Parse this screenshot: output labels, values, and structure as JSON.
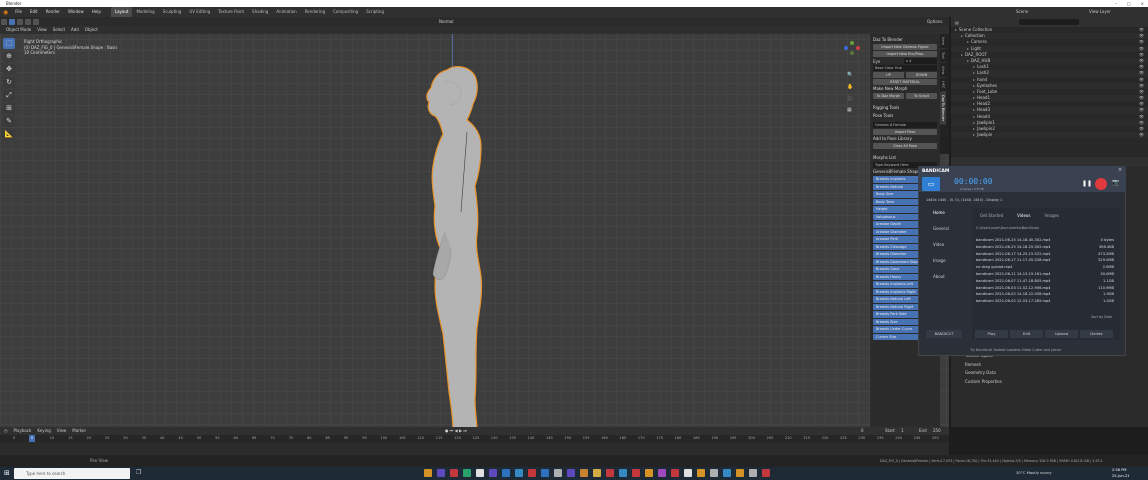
{
  "window": {
    "title": "Blender"
  },
  "menu": {
    "items": [
      "File",
      "Edit",
      "Render",
      "Window",
      "Help"
    ],
    "workspaces": [
      "Layout",
      "Modeling",
      "Sculpting",
      "UV Editing",
      "Texture Paint",
      "Shading",
      "Animation",
      "Rendering",
      "Compositing",
      "Scripting"
    ],
    "active_workspace": "Layout",
    "scene_label": "Scene",
    "view_layer_label": "View Layer"
  },
  "viewport": {
    "mode": "Object Mode",
    "menus": [
      "View",
      "Select",
      "Add",
      "Object"
    ],
    "orientation": "Normal",
    "options_label": "Options",
    "info_line1": "Right Orthographic",
    "info_line2": "(0) DAZ_FIG_0 | Genesis8Female.Shape : Basis",
    "info_line3": "10 Centimeters"
  },
  "npanel": {
    "day_to_blender_title": "Daz To Blender",
    "import_new_genesis": "Import New Genesis Figure",
    "import_new_env": "Import New Env/Prop",
    "eye_label": "Eye",
    "eye_value": "x 4",
    "base_color_hue": "Base Color Hue",
    "up_label": "UP",
    "down_label": "DOWN",
    "reset_material": "RESET MATERIAL",
    "make_new_morph": "Make New Morph",
    "to_daz_morph": "To Daz Morph",
    "to_script": "To Script",
    "rigging_tools": "Rigging Tools",
    "pose_tools": "Pose Tools",
    "pose_preset": "Genesis 8 Female",
    "import_pose": "Import Pose",
    "add_to_pose_library": "Add to Pose Library",
    "clear_all_pose": "Clear All Pose",
    "morphs_list": "Morphs List",
    "search_placeholder": "Type Keyword Here",
    "shape_key": "Genesis8Female.Shape",
    "morphs": [
      {
        "name": "Breasts Implants",
        "value": ""
      },
      {
        "name": "Breasts Natural",
        "value": ""
      },
      {
        "name": "Body Size",
        "value": ""
      },
      {
        "name": "Body Tone",
        "value": ""
      },
      {
        "name": "Height",
        "value": ""
      },
      {
        "name": "Voluptuous",
        "value": ""
      },
      {
        "name": "Areolae Depth",
        "value": ""
      },
      {
        "name": "Areolae Diameter",
        "value": ""
      },
      {
        "name": "Areolae Perk",
        "value": ""
      },
      {
        "name": "Breasts Cleavage",
        "value": ""
      },
      {
        "name": "Breasts Diameter",
        "value": ""
      },
      {
        "name": "Breasts Downward Slope",
        "value": ""
      },
      {
        "name": "Breasts Gone",
        "value": "0.000"
      },
      {
        "name": "Breasts Heavy",
        "value": "0.000"
      },
      {
        "name": "Breasts Implants Left",
        "value": "0.000"
      },
      {
        "name": "Breasts Implants Right",
        "value": "0.000"
      },
      {
        "name": "Breasts Natural Left",
        "value": "0.000"
      },
      {
        "name": "Breasts Natural Right",
        "value": "0.000"
      },
      {
        "name": "Breasts Perk Side",
        "value": "0.000"
      },
      {
        "name": "Breasts Size",
        "value": "0.000"
      },
      {
        "name": "Breasts Under Curve",
        "value": "0.000"
      },
      {
        "name": "Curves Size",
        "value": "0.000"
      }
    ],
    "tabs": [
      "Item",
      "Tool",
      "View",
      "HPC",
      "Daz To Blender"
    ]
  },
  "outliner": {
    "rows": [
      {
        "indent": 0,
        "label": "Scene Collection"
      },
      {
        "indent": 1,
        "label": "Collection"
      },
      {
        "indent": 2,
        "label": "Camera"
      },
      {
        "indent": 2,
        "label": "Light"
      },
      {
        "indent": 1,
        "label": "DAZ_ROOT"
      },
      {
        "indent": 2,
        "label": "DAZ_HUB"
      },
      {
        "indent": 3,
        "label": "Lash1"
      },
      {
        "indent": 3,
        "label": "Lash2"
      },
      {
        "indent": 3,
        "label": "hand"
      },
      {
        "indent": 3,
        "label": "Eyelashes"
      },
      {
        "indent": 3,
        "label": "Foot_Lobe"
      },
      {
        "indent": 3,
        "label": "Head1"
      },
      {
        "indent": 3,
        "label": "Head2"
      },
      {
        "indent": 3,
        "label": "Head3"
      },
      {
        "indent": 3,
        "label": "Head4"
      },
      {
        "indent": 3,
        "label": "Jawlipin1"
      },
      {
        "indent": 3,
        "label": "Jawlipin2"
      },
      {
        "indent": 3,
        "label": "Jawlipin"
      }
    ]
  },
  "properties": {
    "sections": [
      "Texture Space",
      "Remesh",
      "Geometry Data",
      "Custom Properties"
    ]
  },
  "timeline": {
    "menus": [
      "Playback",
      "Keying",
      "View",
      "Marker"
    ],
    "current_frame": "0",
    "start_label": "Start",
    "start_value": "1",
    "end_label": "End",
    "end_value": "250",
    "frame_display": "0",
    "ticks": [
      "0",
      "5",
      "10",
      "15",
      "20",
      "25",
      "30",
      "35",
      "40",
      "45",
      "50",
      "55",
      "60",
      "65",
      "70",
      "75",
      "80",
      "85",
      "90",
      "95",
      "100",
      "105",
      "110",
      "115",
      "120",
      "125",
      "130",
      "135",
      "140",
      "145",
      "150",
      "155",
      "160",
      "165",
      "170",
      "175",
      "180",
      "185",
      "190",
      "195",
      "200",
      "205",
      "210",
      "215",
      "220",
      "225",
      "230",
      "235",
      "240",
      "245",
      "250"
    ]
  },
  "statusbar": {
    "left": "Pan View",
    "right": "DAZ_FIG_0 | Genesis8Female | Verts:17,033 | Faces:16,750 | Tris:33,440 | Objects:3/5 | Memory: 504.5 MiB | VRAM: 0.8/3.8 GiB | 2.93.1"
  },
  "taskbar": {
    "search_placeholder": "Type here to search",
    "weather": "30°C  Mostly sunny",
    "time": "2:56 PM",
    "date": "25-Jun-21"
  },
  "bandicam": {
    "brand": "BANDICAM",
    "timer": "00:00:00",
    "size": "0 bytes / 3.8 TB",
    "capture_target": "1440x 1440 - (0, 0), (1440, 1440) - Display 1",
    "nav": [
      "Home",
      "General",
      "Video",
      "Image",
      "About"
    ],
    "tabs": [
      "Get Started",
      "Videos",
      "Images"
    ],
    "folder": "C:\\Users\\user\\Documents\\Bandicam",
    "files": [
      {
        "name": "bandicam 2021-06-25 14-18-40-302.mp4",
        "size": "0 bytes"
      },
      {
        "name": "bandicam 2021-06-25 14-18-25-502.mp4",
        "size": "306.4KB"
      },
      {
        "name": "bandicam 2021-06-17 14-25-15-522.mp4",
        "size": "473.2MB"
      },
      {
        "name": "bandicam 2021-06-17 11-17-45-528.mp4",
        "size": "329.0MB"
      },
      {
        "name": "no drag upload.mp4",
        "size": "2.0MB"
      },
      {
        "name": "bandicam 2021-06-11 14-13-19-181.mp4",
        "size": "30.0MB"
      },
      {
        "name": "bandicam 2021-06-07 11-47-18-805.mp4",
        "size": "1.1GB"
      },
      {
        "name": "bandicam 2021-06-03 11-52-12-906.mp4",
        "size": "110.9MB"
      },
      {
        "name": "bandicam 2021-06-02 14-18-22-058.mp4",
        "size": "1.9GB"
      },
      {
        "name": "bandicam 2021-06-02 12-53-17-285.mp4",
        "size": "1.0GB"
      }
    ],
    "sort_label": "Sort by Date",
    "cut_label": "BANDICUT",
    "actions": [
      "Play",
      "Edit",
      "Upload",
      "Delete"
    ],
    "footer": "Try Bandicut! Fastest Lossless Video Cutter and Joiner"
  },
  "colors": {
    "accent": "#4772b3",
    "selection": "#e8922c",
    "record": "#e0393e",
    "bandicam_timer": "#4aa8ff"
  }
}
